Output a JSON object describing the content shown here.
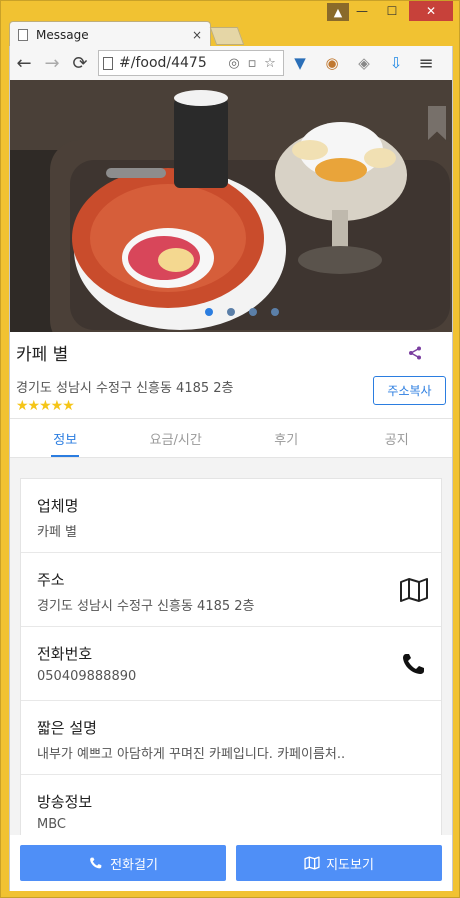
{
  "window": {
    "tab_title": "Message",
    "tab_close": "×",
    "controls": {
      "minimize": "—",
      "maximize": "☐",
      "close": "✕"
    }
  },
  "toolbar": {
    "back": "←",
    "forward": "→",
    "reload": "⟳",
    "url": "#/food/4475",
    "menu": "≡"
  },
  "shop": {
    "name": "카페 별",
    "address": "경기도 성남시 수정구 신흥동 4185 2층",
    "rating_stars": "★★★★★",
    "copy_address_label": "주소복사"
  },
  "carousel": {
    "count": 4,
    "active_index": 0
  },
  "tabs": [
    {
      "label": "정보",
      "active": true
    },
    {
      "label": "요금/시간",
      "active": false
    },
    {
      "label": "후기",
      "active": false
    },
    {
      "label": "공지",
      "active": false
    }
  ],
  "details": {
    "business_name": {
      "label": "업체명",
      "value": "카페 별"
    },
    "address": {
      "label": "주소",
      "value": "경기도 성남시 수정구 신흥동 4185 2층"
    },
    "phone": {
      "label": "전화번호",
      "value": "050409888890"
    },
    "short_desc": {
      "label": "짧은 설명",
      "value": "내부가 예쁘고 아담하게 꾸며진 카페입니다. 카페이름처.."
    },
    "broadcast": {
      "label": "방송정보",
      "value": "MBC"
    }
  },
  "actions": {
    "call_label": "전화걸기",
    "map_label": "지도보기"
  },
  "colors": {
    "accent": "#2b7de0",
    "button": "#4f8ff7",
    "star": "#f5c518",
    "share": "#7b3fa0"
  }
}
